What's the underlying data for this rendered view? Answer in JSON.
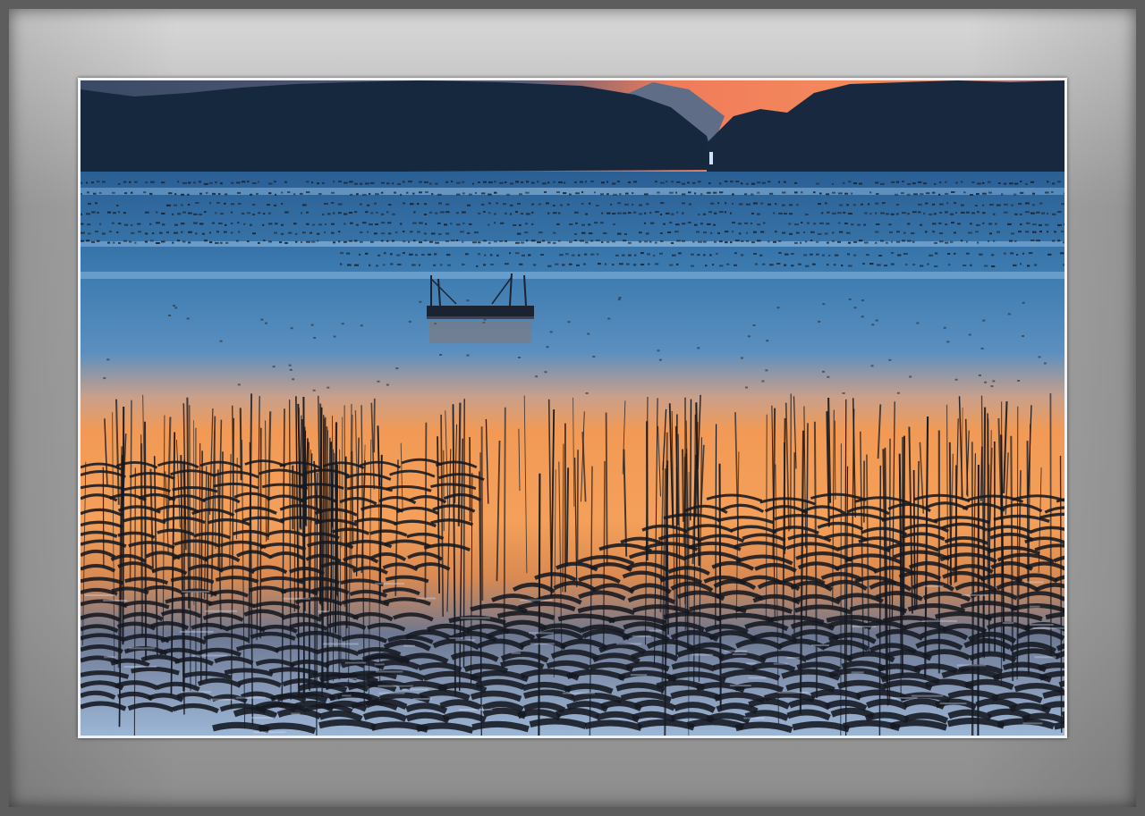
{
  "scene": {
    "subject": "seaweed-farm-at-dusk",
    "colors": {
      "sky_sunset": "#f0805a",
      "hills_silhouette": "#16283e",
      "water_blue": "#3a78ad",
      "water_orange": "#f29a55",
      "stakes_dark": "#141820",
      "mat_light": "#d6d6d6",
      "mat_dark": "#8e8e8e"
    }
  }
}
